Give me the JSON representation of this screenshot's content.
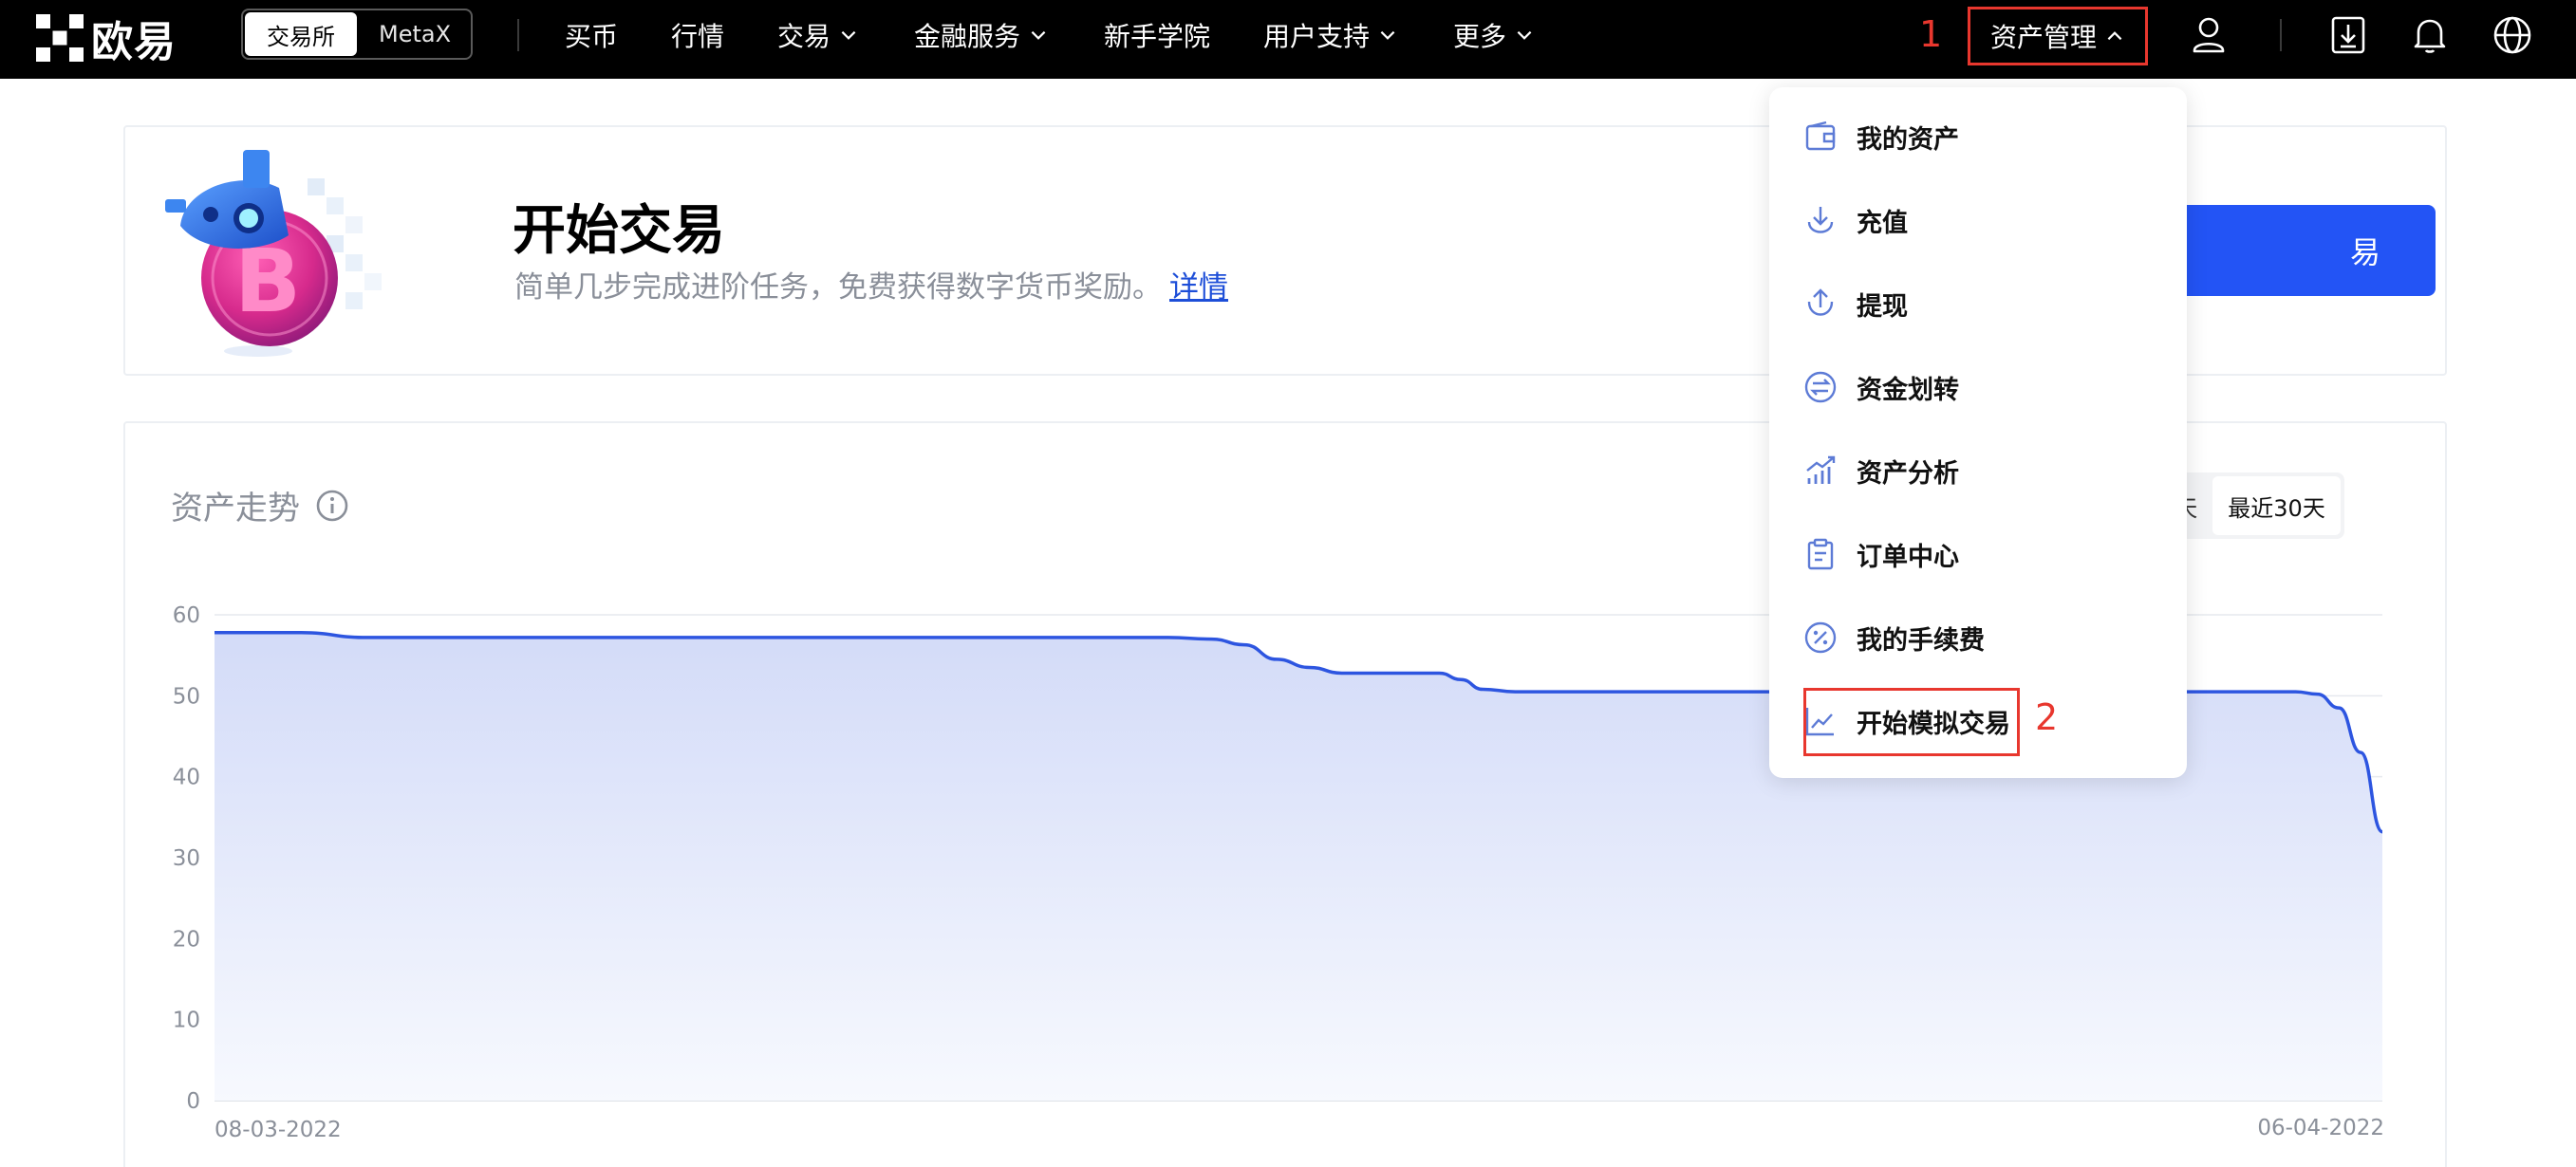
{
  "brand": {
    "logo_text": "欧易"
  },
  "mode_switch": {
    "exchange": "交易所",
    "metax": "MetaX"
  },
  "nav": {
    "items": [
      {
        "label": "买币"
      },
      {
        "label": "行情"
      },
      {
        "label": "交易"
      },
      {
        "label": "金融服务"
      },
      {
        "label": "新手学院"
      },
      {
        "label": "用户支持"
      },
      {
        "label": "更多"
      }
    ],
    "asset_management": "资产管理"
  },
  "annotations": {
    "marker1": "1",
    "marker2": "2"
  },
  "banner": {
    "title": "开始交易",
    "subtitle": "简单几步完成进阶任务，免费获得数字货币奖励。",
    "link": "详情",
    "button_visible_text": "易"
  },
  "chart_section": {
    "title": "资产走势",
    "ranges": [
      {
        "label": "近7天"
      },
      {
        "label": "最近30天"
      }
    ],
    "active_range": "最近30天"
  },
  "dropdown": {
    "items": [
      {
        "label": "我的资产",
        "icon": "wallet-icon"
      },
      {
        "label": "充值",
        "icon": "deposit-icon"
      },
      {
        "label": "提现",
        "icon": "withdraw-icon"
      },
      {
        "label": "资金划转",
        "icon": "transfer-icon"
      },
      {
        "label": "资产分析",
        "icon": "analysis-icon"
      },
      {
        "label": "订单中心",
        "icon": "clipboard-icon"
      },
      {
        "label": "我的手续费",
        "icon": "fee-icon"
      },
      {
        "label": "开始模拟交易",
        "icon": "trend-chart-icon"
      }
    ]
  },
  "colors": {
    "accent_blue": "#2354f5",
    "annotation_red": "#e8372e",
    "line_blue": "#2d55e0"
  },
  "chart_data": {
    "type": "area",
    "x_start_label": "08-03-2022",
    "x_end_label": "06-04-2022",
    "y_ticks": [
      0,
      10,
      20,
      30,
      40,
      50,
      60
    ],
    "ylim": [
      0,
      60
    ],
    "grid": true,
    "series": [
      {
        "points": [
          [
            0,
            57.8
          ],
          [
            0.04,
            57.8
          ],
          [
            0.07,
            57.2
          ],
          [
            0.2,
            57.2
          ],
          [
            0.35,
            57.2
          ],
          [
            0.44,
            57.2
          ],
          [
            0.46,
            57.0
          ],
          [
            0.475,
            56.3
          ],
          [
            0.49,
            54.5
          ],
          [
            0.505,
            53.5
          ],
          [
            0.52,
            52.8
          ],
          [
            0.55,
            52.8
          ],
          [
            0.565,
            52.8
          ],
          [
            0.575,
            52.0
          ],
          [
            0.585,
            50.8
          ],
          [
            0.6,
            50.5
          ],
          [
            0.7,
            50.5
          ],
          [
            0.8,
            50.5
          ],
          [
            0.9,
            50.5
          ],
          [
            0.96,
            50.5
          ],
          [
            0.97,
            50.2
          ],
          [
            0.98,
            48.5
          ],
          [
            0.99,
            43.0
          ],
          [
            1.0,
            33.2
          ]
        ]
      }
    ]
  }
}
